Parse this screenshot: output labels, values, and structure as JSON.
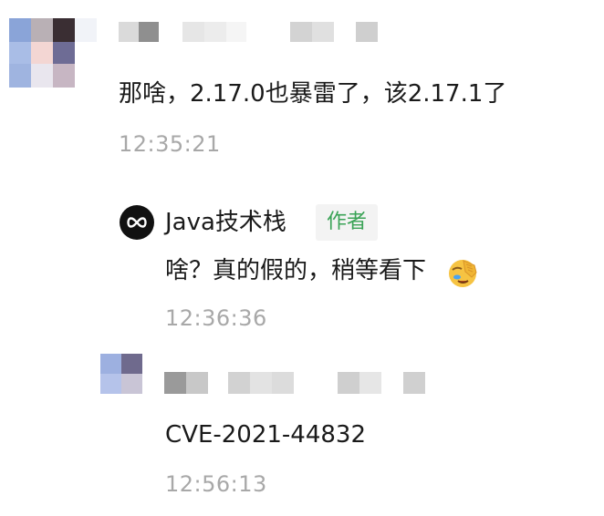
{
  "comments": [
    {
      "text": "那啥，2.17.0也暴雷了，该2.17.1了",
      "time": "12:35:21",
      "avatar_colors": [
        "#8aa4d8",
        "#b9b0b5",
        "#3a2e33",
        "#f1f3f8",
        "#a9bde6",
        "#f3d6d3",
        "#6e6c95",
        "#ffffff",
        "#9fb4e0",
        "#e9e6ee",
        "#c7b6c3",
        "#ffffff"
      ],
      "name_blur_colors": [
        "#dadada",
        "#8f8f8f",
        "#e6e6e6",
        "#ececec",
        "#f5f5f5",
        "#d3d3d3",
        "#e0e0e0",
        "#cfcfcf"
      ]
    },
    {
      "author": "Java技术栈",
      "badge": "作者",
      "text": "啥？真的假的，稍等看下",
      "emoji_icon": "face-palm-crying-icon",
      "time": "12:36:36"
    },
    {
      "text": "CVE-2021-44832",
      "time": "12:56:13",
      "avatar_colors": [
        "#9db0e0",
        "#6f6a8d",
        "#b5c3ea",
        "#c9c5d6"
      ],
      "name_blur_colors": [
        "#9a9a9a",
        "#c8c8c8",
        "#d2d2d2",
        "#e3e3e3",
        "#dcdcdc",
        "#cfcfcf",
        "#e6e6e6",
        "#d0d0d0"
      ]
    }
  ]
}
